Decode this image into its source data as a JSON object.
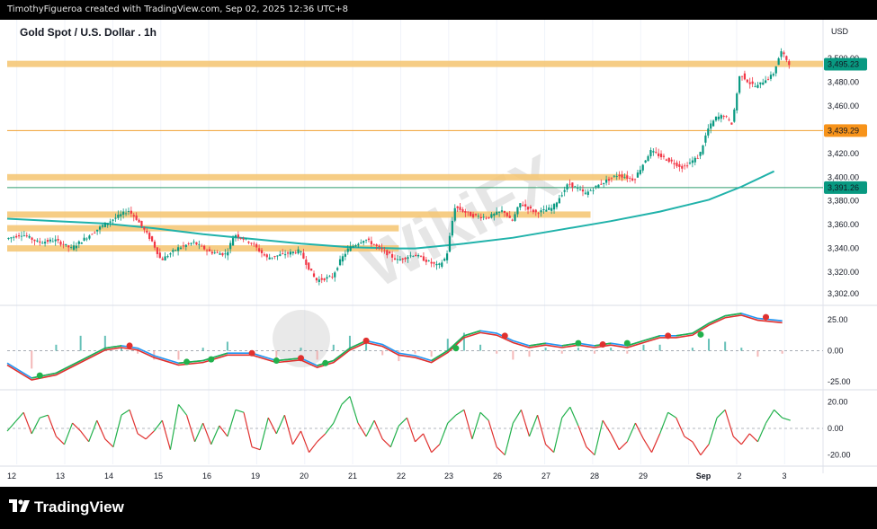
{
  "header": {
    "attribution": "TimothyFigueroa created with TradingView.com, Sep 02, 2025 12:36 UTC+8"
  },
  "footer": {
    "brand": "TradingView"
  },
  "watermark": {
    "text": "WikiFX"
  },
  "chart_data": {
    "type": "line",
    "title": "Gold Spot / U.S. Dollar . 1h",
    "currency_label": "USD",
    "x_labels": [
      "12",
      "13",
      "14",
      "15",
      "16",
      "19",
      "20",
      "21",
      "22",
      "23",
      "26",
      "27",
      "28",
      "29",
      "Sep",
      "2",
      "3"
    ],
    "price_panel": {
      "ylim": [
        3292,
        3510
      ],
      "y_ticks": [
        "3,500.00",
        "3,480.00",
        "3,460.00",
        "3,440.00",
        "3,420.00",
        "3,400.00",
        "3,380.00",
        "3,360.00",
        "3,340.00",
        "3,320.00",
        "3,302.00"
      ],
      "price_axis_labels": [
        {
          "text": "3,495.23",
          "value": 3495.23,
          "color": "#089981"
        },
        {
          "text": "3,439.29",
          "value": 3439.29,
          "color": "#f7931a"
        },
        {
          "text": "3,391.26",
          "value": 3391.26,
          "color": "#089981"
        }
      ],
      "horizontal_lines": [
        {
          "value": 3439.29,
          "color": "#f0a030"
        },
        {
          "value": 3391.26,
          "color": "#2e9e6e"
        }
      ],
      "zones": [
        {
          "value": 3495.5,
          "x_end": 1.0,
          "color": "#f5c470"
        },
        {
          "value": 3400,
          "x_end": 0.76,
          "color": "#f5c470"
        },
        {
          "value": 3368.5,
          "x_end": 0.715,
          "color": "#f5c470"
        },
        {
          "value": 3357,
          "x_end": 0.48,
          "color": "#f5c470"
        },
        {
          "value": 3340,
          "x_end": 0.48,
          "color": "#f5c470"
        }
      ],
      "moving_average": {
        "color": "#20b2aa",
        "points": [
          [
            0,
            3365
          ],
          [
            0.06,
            3363
          ],
          [
            0.12,
            3361
          ],
          [
            0.18,
            3357
          ],
          [
            0.24,
            3352
          ],
          [
            0.3,
            3348
          ],
          [
            0.36,
            3344
          ],
          [
            0.42,
            3341
          ],
          [
            0.48,
            3340
          ],
          [
            0.5,
            3340
          ],
          [
            0.56,
            3344
          ],
          [
            0.62,
            3349
          ],
          [
            0.68,
            3356
          ],
          [
            0.74,
            3363
          ],
          [
            0.8,
            3371
          ],
          [
            0.86,
            3381
          ],
          [
            0.9,
            3392
          ],
          [
            0.94,
            3405
          ]
        ]
      },
      "price_path": [
        [
          0,
          3348
        ],
        [
          0.02,
          3352
        ],
        [
          0.04,
          3345
        ],
        [
          0.06,
          3347
        ],
        [
          0.08,
          3340
        ],
        [
          0.1,
          3350
        ],
        [
          0.12,
          3360
        ],
        [
          0.14,
          3368
        ],
        [
          0.15,
          3372
        ],
        [
          0.16,
          3365
        ],
        [
          0.17,
          3355
        ],
        [
          0.18,
          3345
        ],
        [
          0.19,
          3330
        ],
        [
          0.21,
          3340
        ],
        [
          0.23,
          3345
        ],
        [
          0.25,
          3337
        ],
        [
          0.27,
          3335
        ],
        [
          0.28,
          3352
        ],
        [
          0.3,
          3345
        ],
        [
          0.32,
          3332
        ],
        [
          0.34,
          3335
        ],
        [
          0.36,
          3338
        ],
        [
          0.37,
          3325
        ],
        [
          0.38,
          3313
        ],
        [
          0.4,
          3316
        ],
        [
          0.41,
          3330
        ],
        [
          0.42,
          3340
        ],
        [
          0.44,
          3348
        ],
        [
          0.46,
          3339
        ],
        [
          0.48,
          3330
        ],
        [
          0.5,
          3335
        ],
        [
          0.52,
          3328
        ],
        [
          0.53,
          3325
        ],
        [
          0.54,
          3333
        ],
        [
          0.55,
          3375
        ],
        [
          0.57,
          3368
        ],
        [
          0.59,
          3366
        ],
        [
          0.61,
          3372
        ],
        [
          0.62,
          3362
        ],
        [
          0.63,
          3378
        ],
        [
          0.65,
          3370
        ],
        [
          0.67,
          3374
        ],
        [
          0.69,
          3395
        ],
        [
          0.71,
          3386
        ],
        [
          0.73,
          3395
        ],
        [
          0.75,
          3402
        ],
        [
          0.77,
          3398
        ],
        [
          0.79,
          3422
        ],
        [
          0.81,
          3415
        ],
        [
          0.83,
          3408
        ],
        [
          0.85,
          3418
        ],
        [
          0.86,
          3440
        ],
        [
          0.87,
          3450
        ],
        [
          0.88,
          3452
        ],
        [
          0.89,
          3445
        ],
        [
          0.9,
          3488
        ],
        [
          0.91,
          3480
        ],
        [
          0.92,
          3476
        ],
        [
          0.93,
          3482
        ],
        [
          0.94,
          3486
        ],
        [
          0.945,
          3496
        ],
        [
          0.95,
          3506
        ],
        [
          0.96,
          3496
        ]
      ]
    },
    "macd_panel": {
      "ylim": [
        -30,
        35
      ],
      "y_ticks": [
        "25.00",
        "0.00",
        "-25.00"
      ],
      "macd_color": "#2196f3",
      "signal_color": "#e0312f",
      "trend_up_color": "#22b14c",
      "line_points": [
        [
          0,
          -10
        ],
        [
          0.03,
          -22
        ],
        [
          0.06,
          -18
        ],
        [
          0.09,
          -8
        ],
        [
          0.12,
          2
        ],
        [
          0.14,
          4
        ],
        [
          0.16,
          2
        ],
        [
          0.18,
          -4
        ],
        [
          0.21,
          -10
        ],
        [
          0.24,
          -8
        ],
        [
          0.27,
          -2
        ],
        [
          0.3,
          -2
        ],
        [
          0.33,
          -8
        ],
        [
          0.36,
          -6
        ],
        [
          0.38,
          -12
        ],
        [
          0.4,
          -8
        ],
        [
          0.42,
          2
        ],
        [
          0.44,
          8
        ],
        [
          0.46,
          5
        ],
        [
          0.48,
          -2
        ],
        [
          0.5,
          -4
        ],
        [
          0.52,
          -8
        ],
        [
          0.54,
          0
        ],
        [
          0.56,
          12
        ],
        [
          0.58,
          16
        ],
        [
          0.6,
          14
        ],
        [
          0.62,
          8
        ],
        [
          0.64,
          4
        ],
        [
          0.66,
          6
        ],
        [
          0.68,
          4
        ],
        [
          0.7,
          6
        ],
        [
          0.72,
          4
        ],
        [
          0.74,
          6
        ],
        [
          0.76,
          4
        ],
        [
          0.78,
          8
        ],
        [
          0.8,
          12
        ],
        [
          0.82,
          12
        ],
        [
          0.84,
          14
        ],
        [
          0.86,
          22
        ],
        [
          0.88,
          28
        ],
        [
          0.9,
          30
        ],
        [
          0.92,
          26
        ],
        [
          0.95,
          24
        ]
      ],
      "crossovers": [
        {
          "x": 0.04,
          "v": -20,
          "color": "#22b14c"
        },
        {
          "x": 0.15,
          "v": 4,
          "color": "#e0312f"
        },
        {
          "x": 0.22,
          "v": -9,
          "color": "#22b14c"
        },
        {
          "x": 0.25,
          "v": -7,
          "color": "#22b14c"
        },
        {
          "x": 0.3,
          "v": -2,
          "color": "#e0312f"
        },
        {
          "x": 0.33,
          "v": -8,
          "color": "#22b14c"
        },
        {
          "x": 0.36,
          "v": -6,
          "color": "#e0312f"
        },
        {
          "x": 0.39,
          "v": -10,
          "color": "#22b14c"
        },
        {
          "x": 0.44,
          "v": 8,
          "color": "#e0312f"
        },
        {
          "x": 0.55,
          "v": 2,
          "color": "#22b14c"
        },
        {
          "x": 0.61,
          "v": 12,
          "color": "#e0312f"
        },
        {
          "x": 0.7,
          "v": 6,
          "color": "#22b14c"
        },
        {
          "x": 0.73,
          "v": 5,
          "color": "#e0312f"
        },
        {
          "x": 0.76,
          "v": 6,
          "color": "#22b14c"
        },
        {
          "x": 0.81,
          "v": 12,
          "color": "#e0312f"
        },
        {
          "x": 0.85,
          "v": 13,
          "color": "#22b14c"
        },
        {
          "x": 0.93,
          "v": 27,
          "color": "#e0312f"
        }
      ]
    },
    "osc_panel": {
      "ylim": [
        -27,
        27
      ],
      "y_ticks": [
        "20.00",
        "0.00",
        "-20.00"
      ],
      "up_color": "#22b14c",
      "down_color": "#e0312f",
      "points": [
        [
          0,
          -2
        ],
        [
          0.01,
          5
        ],
        [
          0.02,
          12
        ],
        [
          0.03,
          -4
        ],
        [
          0.04,
          8
        ],
        [
          0.05,
          10
        ],
        [
          0.06,
          -6
        ],
        [
          0.07,
          -12
        ],
        [
          0.08,
          4
        ],
        [
          0.09,
          -2
        ],
        [
          0.1,
          -10
        ],
        [
          0.11,
          6
        ],
        [
          0.12,
          -8
        ],
        [
          0.13,
          -14
        ],
        [
          0.14,
          10
        ],
        [
          0.15,
          14
        ],
        [
          0.16,
          -4
        ],
        [
          0.17,
          -8
        ],
        [
          0.18,
          -2
        ],
        [
          0.19,
          6
        ],
        [
          0.2,
          -16
        ],
        [
          0.21,
          18
        ],
        [
          0.22,
          10
        ],
        [
          0.23,
          -10
        ],
        [
          0.24,
          4
        ],
        [
          0.25,
          -12
        ],
        [
          0.26,
          2
        ],
        [
          0.27,
          -6
        ],
        [
          0.28,
          14
        ],
        [
          0.29,
          12
        ],
        [
          0.3,
          -14
        ],
        [
          0.31,
          -16
        ],
        [
          0.32,
          8
        ],
        [
          0.33,
          -4
        ],
        [
          0.34,
          10
        ],
        [
          0.35,
          -12
        ],
        [
          0.36,
          -2
        ],
        [
          0.37,
          -18
        ],
        [
          0.38,
          -10
        ],
        [
          0.39,
          -4
        ],
        [
          0.4,
          4
        ],
        [
          0.41,
          18
        ],
        [
          0.42,
          24
        ],
        [
          0.43,
          4
        ],
        [
          0.44,
          -6
        ],
        [
          0.45,
          6
        ],
        [
          0.46,
          -8
        ],
        [
          0.47,
          -14
        ],
        [
          0.48,
          2
        ],
        [
          0.49,
          8
        ],
        [
          0.5,
          -10
        ],
        [
          0.51,
          -4
        ],
        [
          0.52,
          -18
        ],
        [
          0.53,
          -12
        ],
        [
          0.54,
          4
        ],
        [
          0.55,
          10
        ],
        [
          0.56,
          14
        ],
        [
          0.57,
          -8
        ],
        [
          0.58,
          12
        ],
        [
          0.59,
          6
        ],
        [
          0.6,
          -14
        ],
        [
          0.61,
          -20
        ],
        [
          0.62,
          4
        ],
        [
          0.63,
          14
        ],
        [
          0.64,
          -6
        ],
        [
          0.65,
          10
        ],
        [
          0.66,
          -12
        ],
        [
          0.67,
          -18
        ],
        [
          0.68,
          8
        ],
        [
          0.69,
          16
        ],
        [
          0.7,
          2
        ],
        [
          0.71,
          -14
        ],
        [
          0.72,
          -20
        ],
        [
          0.73,
          6
        ],
        [
          0.74,
          -4
        ],
        [
          0.75,
          -16
        ],
        [
          0.76,
          -10
        ],
        [
          0.77,
          4
        ],
        [
          0.78,
          -8
        ],
        [
          0.79,
          -18
        ],
        [
          0.8,
          -4
        ],
        [
          0.81,
          12
        ],
        [
          0.82,
          8
        ],
        [
          0.83,
          -6
        ],
        [
          0.84,
          -10
        ],
        [
          0.85,
          -20
        ],
        [
          0.86,
          -12
        ],
        [
          0.87,
          8
        ],
        [
          0.88,
          14
        ],
        [
          0.89,
          -6
        ],
        [
          0.9,
          -12
        ],
        [
          0.91,
          -4
        ],
        [
          0.92,
          -10
        ],
        [
          0.93,
          4
        ],
        [
          0.94,
          14
        ],
        [
          0.95,
          8
        ],
        [
          0.96,
          6
        ]
      ]
    }
  }
}
